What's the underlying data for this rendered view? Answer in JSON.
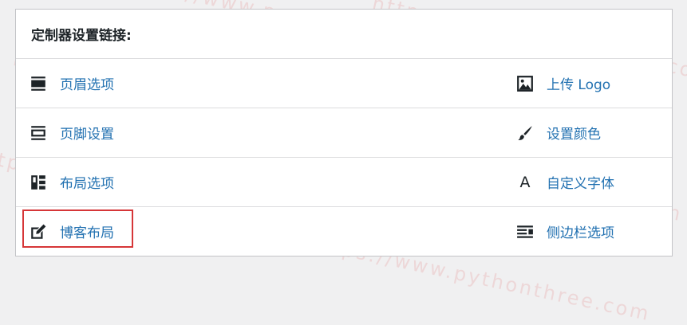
{
  "panel": {
    "title": "定制器设置链接:"
  },
  "rows": [
    {
      "left": {
        "label": "页眉选项",
        "icon": "header-icon"
      },
      "right": {
        "label": "上传 Logo",
        "icon": "image-icon"
      }
    },
    {
      "left": {
        "label": "页脚设置",
        "icon": "footer-icon"
      },
      "right": {
        "label": "设置颜色",
        "icon": "brush-icon"
      }
    },
    {
      "left": {
        "label": "布局选项",
        "icon": "layout-icon"
      },
      "right": {
        "label": "自定义字体",
        "icon": "font-icon",
        "glyph": "A"
      }
    },
    {
      "left": {
        "label": "博客布局",
        "icon": "edit-icon"
      },
      "right": {
        "label": "侧边栏选项",
        "icon": "sidebar-icon"
      }
    }
  ],
  "watermark": {
    "text": "https://www.pythonthree.com"
  },
  "colors": {
    "link": "#2271b1",
    "highlight": "#d63638",
    "border": "#dcdcde"
  }
}
